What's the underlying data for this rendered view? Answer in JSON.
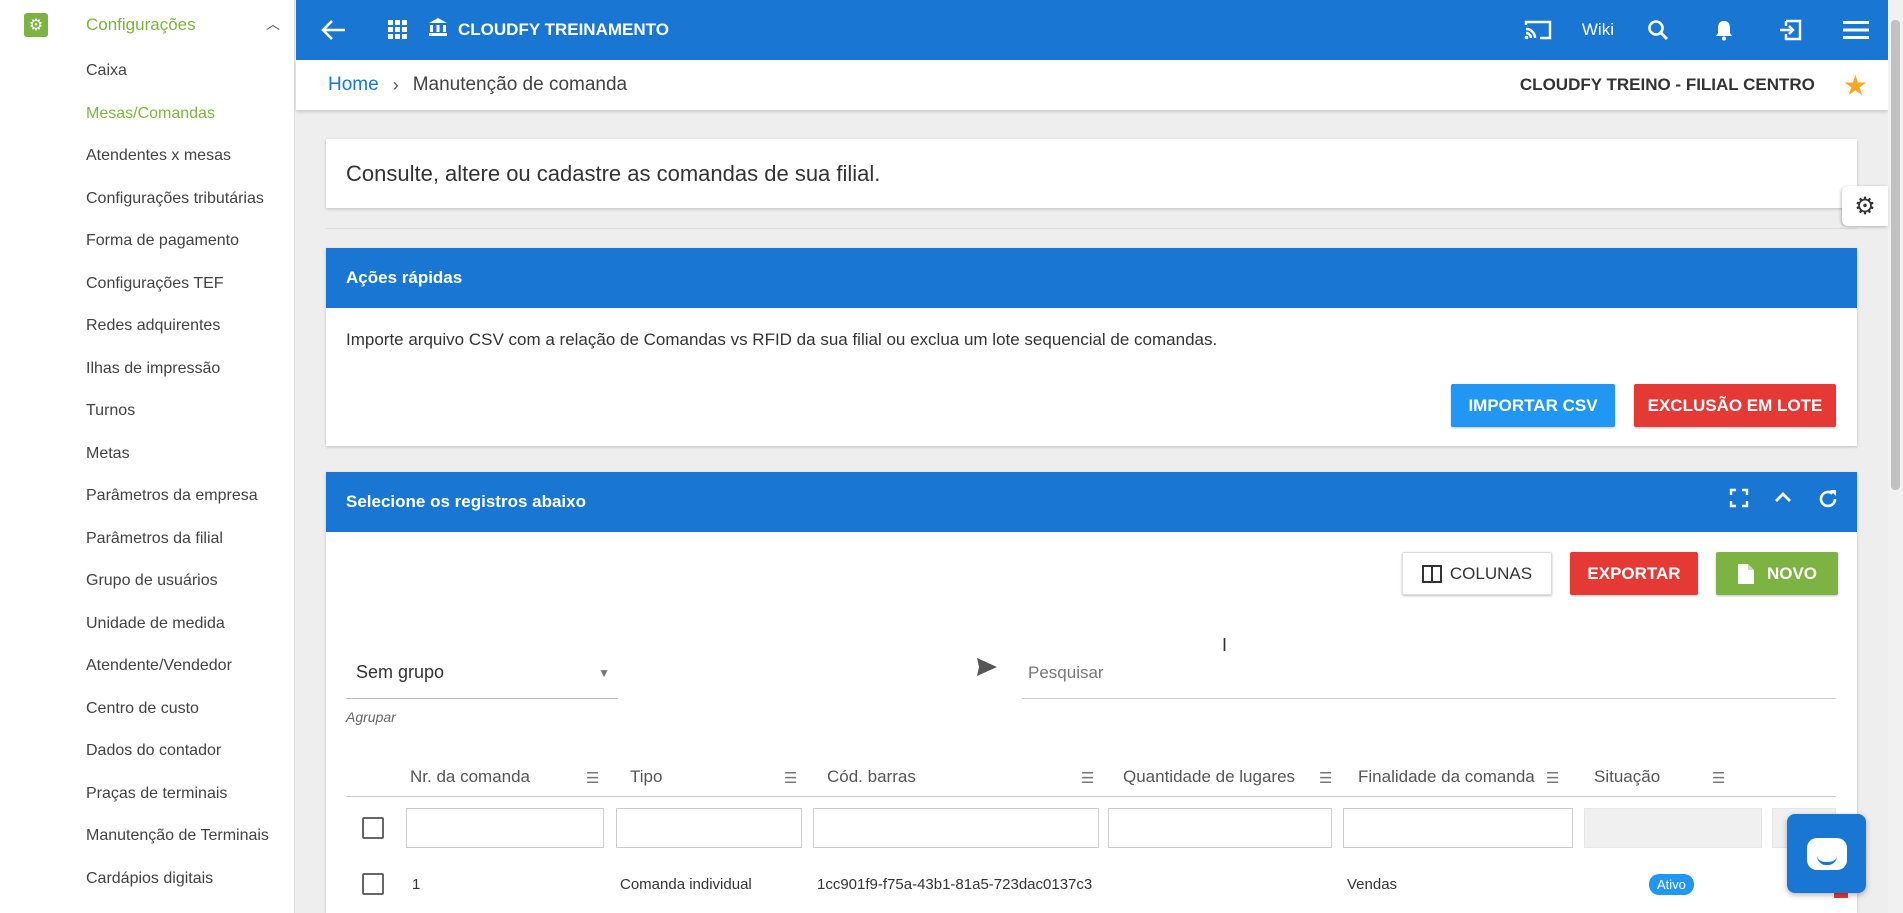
{
  "sidebar": {
    "header_label": "Configurações",
    "items": [
      {
        "label": "Caixa",
        "active": false
      },
      {
        "label": "Mesas/Comandas",
        "active": true
      },
      {
        "label": "Atendentes x mesas",
        "active": false
      },
      {
        "label": "Configurações tributárias",
        "active": false
      },
      {
        "label": "Forma de pagamento",
        "active": false
      },
      {
        "label": "Configurações TEF",
        "active": false
      },
      {
        "label": "Redes adquirentes",
        "active": false
      },
      {
        "label": "Ilhas de impressão",
        "active": false
      },
      {
        "label": "Turnos",
        "active": false
      },
      {
        "label": "Metas",
        "active": false
      },
      {
        "label": "Parâmetros da empresa",
        "active": false
      },
      {
        "label": "Parâmetros da filial",
        "active": false
      },
      {
        "label": "Grupo de usuários",
        "active": false
      },
      {
        "label": "Unidade de medida",
        "active": false
      },
      {
        "label": "Atendente/Vendedor",
        "active": false
      },
      {
        "label": "Centro de custo",
        "active": false
      },
      {
        "label": "Dados do contador",
        "active": false
      },
      {
        "label": "Praças de terminais",
        "active": false
      },
      {
        "label": "Manutenção de Terminais",
        "active": false
      },
      {
        "label": "Cardápios digitais",
        "active": false
      }
    ]
  },
  "topbar": {
    "app_title": "CLOUDFY TREINAMENTO",
    "wiki_label": "Wiki",
    "icons": [
      "back-arrow-icon",
      "apps-grid-icon",
      "bank-icon",
      "cast-icon",
      "search-icon",
      "bell-icon",
      "exit-icon",
      "menu-icon"
    ]
  },
  "breadcrumb": {
    "home": "Home",
    "current": "Manutenção de comanda",
    "company": "CLOUDFY TREINO - FILIAL CENTRO"
  },
  "intro": {
    "text": "Consulte, altere ou cadastre as comandas de sua filial."
  },
  "quick_actions": {
    "title": "Ações rápidas",
    "description": "Importe arquivo CSV com a relação de Comandas vs RFID da sua filial ou exclua um lote sequencial de comandas.",
    "import_label": "IMPORTAR CSV",
    "batch_delete_label": "EXCLUSÃO EM LOTE"
  },
  "records": {
    "title": "Selecione os registros abaixo",
    "columns_label": "COLUNAS",
    "export_label": "EXPORTAR",
    "new_label": "NOVO",
    "group_value": "Sem grupo",
    "group_caption": "Agrupar",
    "search_placeholder": "Pesquisar",
    "headers": {
      "nr": "Nr. da comanda",
      "tipo": "Tipo",
      "barcode": "Cód. barras",
      "seats": "Quantidade de lugares",
      "purpose": "Finalidade da comanda",
      "status": "Situação"
    },
    "rows": [
      {
        "nr": "1",
        "tipo": "Comanda individual",
        "barcode": "1cc901f9-f75a-43b1-81a5-723dac0137c3",
        "seats": "",
        "purpose": "Vendas",
        "status": "Ativo"
      }
    ]
  },
  "colors": {
    "primary": "#1976d2",
    "accent_green": "#7cb342",
    "danger": "#e53935",
    "info": "#2196f3",
    "star": "#f9a825"
  }
}
